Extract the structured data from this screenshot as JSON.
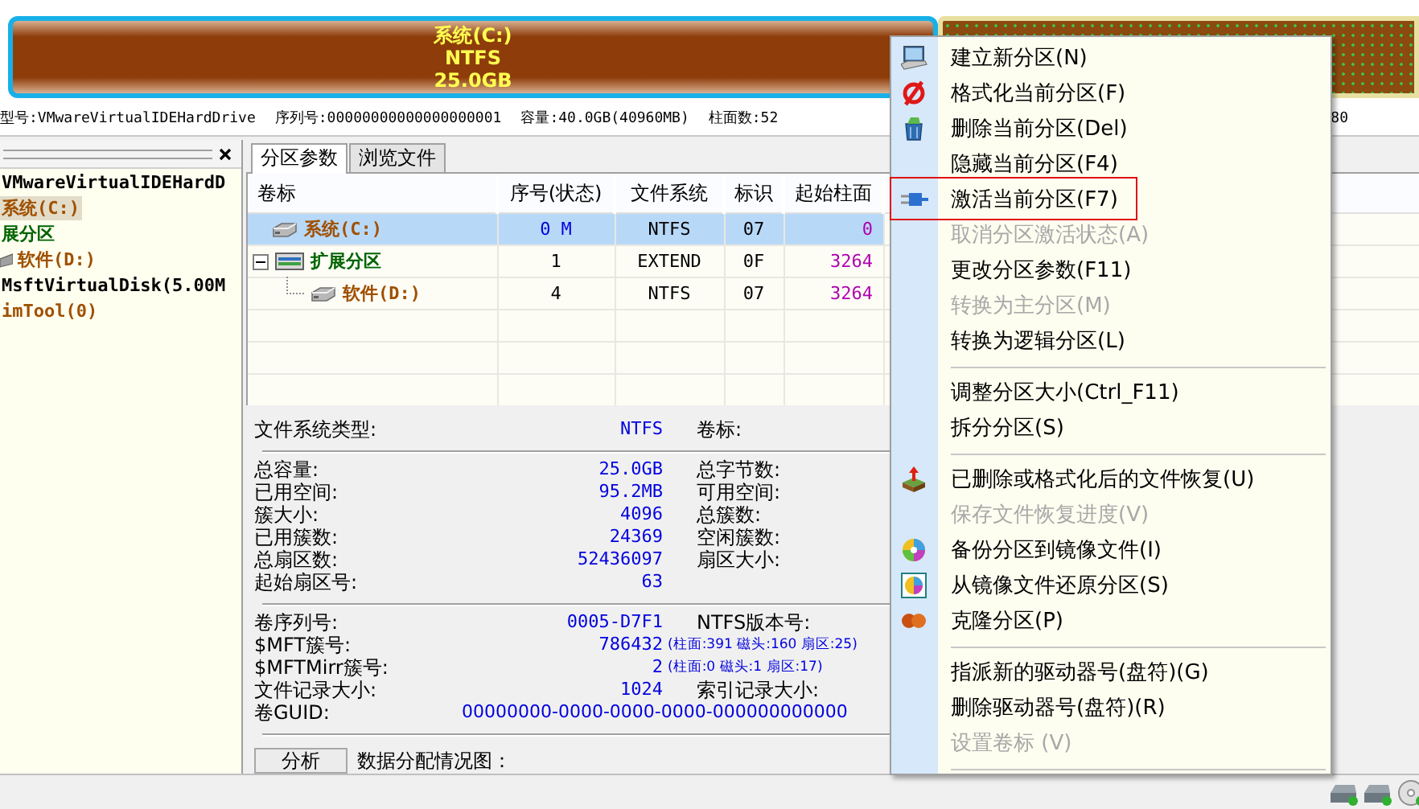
{
  "disk_map": {
    "partitions": [
      {
        "label": "系统(C:)",
        "file_system": "NTFS",
        "size": "25.0GB",
        "selected": true
      },
      {
        "selected": false
      }
    ]
  },
  "disk_info": [
    "型号:VMwareVirtualIDEHardDrive",
    "序列号:00000000000000000001",
    "容量:40.0GB(40960MB)",
    "柱面数:52",
    "80"
  ],
  "tree": [
    {
      "label": "VMwareVirtualIDEHardD",
      "kind": "disk",
      "children": [
        {
          "label": "系统(C:)",
          "kind": "primary",
          "selected": true
        },
        {
          "label": "展分区",
          "kind": "extended",
          "selected": false,
          "children": [
            {
              "label": "软件(D:)",
              "kind": "logical",
              "selected": false
            }
          ]
        }
      ]
    },
    {
      "label": "MsftVirtualDisk(5.00M",
      "kind": "disk",
      "children": [
        {
          "label": "imTool(0)",
          "kind": "primary",
          "selected": false
        }
      ]
    }
  ],
  "tabs": [
    {
      "label": "分区参数",
      "selected": true
    },
    {
      "label": "浏览文件",
      "selected": false
    }
  ],
  "table": {
    "columns": [
      "卷标",
      "序号(状态)",
      "文件系统",
      "标识",
      "起始柱面"
    ],
    "rows": [
      {
        "name": "系统(C:)",
        "kind": "primary",
        "index": "0 M",
        "file_system": "NTFS",
        "id": "07",
        "start_cylinder": "0",
        "selected": true
      },
      {
        "name": "扩展分区",
        "kind": "extended",
        "index": "1",
        "file_system": "EXTEND",
        "id": "0F",
        "start_cylinder": "3264",
        "selected": false,
        "expanded": true,
        "children": [
          {
            "name": "软件(D:)",
            "kind": "logical",
            "index": "4",
            "file_system": "NTFS",
            "id": "07",
            "start_cylinder": "3264",
            "selected": false
          }
        ]
      }
    ]
  },
  "details": [
    [
      {
        "label": "文件系统类型:",
        "value": "NTFS",
        "label_2": "卷标:"
      }
    ],
    [
      {
        "label": "总容量:",
        "value": "25.0GB",
        "label_2": "总字节数:"
      },
      {
        "label": "已用空间:",
        "value": "95.2MB",
        "label_2": "可用空间:"
      },
      {
        "label": "簇大小:",
        "value": "4096",
        "label_2": "总簇数:"
      },
      {
        "label": "已用簇数:",
        "value": "24369",
        "label_2": "空闲簇数:"
      },
      {
        "label": "总扇区数:",
        "value": "52436097",
        "label_2": "扇区大小:"
      },
      {
        "label": "起始扇区号:",
        "value": "63"
      }
    ],
    [
      {
        "label": "卷序列号:",
        "value": "0005-D7F1",
        "label_2": "NTFS版本号:"
      },
      {
        "label": "$MFT簇号:",
        "value": "786432",
        "detail": "(柱面:391 磁头:160 扇区:25)"
      },
      {
        "label": "$MFTMirr簇号:",
        "value": "2",
        "detail": "(柱面:0 磁头:1 扇区:17)"
      },
      {
        "label": "文件记录大小:",
        "value": "1024",
        "label_2": "索引记录大小:"
      },
      {
        "label": "卷GUID:",
        "value": "00000000-0000-0000-0000-000000000000",
        "kind": "wide"
      }
    ]
  ],
  "analyze_button": "分析",
  "allocation_label": "数据分配情况图：",
  "menu": {
    "items": [
      {
        "kind": "item",
        "label": "建立新分区(N)",
        "disabled": false
      },
      {
        "kind": "item",
        "label": "格式化当前分区(F)",
        "disabled": false
      },
      {
        "kind": "item",
        "label": "删除当前分区(Del)",
        "disabled": false
      },
      {
        "kind": "item",
        "label": "隐藏当前分区(F4)",
        "disabled": false
      },
      {
        "kind": "item",
        "label": "激活当前分区(F7)",
        "disabled": false,
        "highlighted": true
      },
      {
        "kind": "item",
        "label": "取消分区激活状态(A)",
        "disabled": true
      },
      {
        "kind": "item",
        "label": "更改分区参数(F11)",
        "disabled": false
      },
      {
        "kind": "item",
        "label": "转换为主分区(M)",
        "disabled": true
      },
      {
        "kind": "item",
        "label": "转换为逻辑分区(L)",
        "disabled": false
      },
      {
        "kind": "separator"
      },
      {
        "kind": "item",
        "label": "调整分区大小(Ctrl_F11)",
        "disabled": false
      },
      {
        "kind": "item",
        "label": "拆分分区(S)",
        "disabled": false
      },
      {
        "kind": "separator"
      },
      {
        "kind": "item",
        "label": "已删除或格式化后的文件恢复(U)",
        "disabled": false
      },
      {
        "kind": "item",
        "label": "保存文件恢复进度(V)",
        "disabled": true
      },
      {
        "kind": "item",
        "label": "备份分区到镜像文件(I)",
        "disabled": false
      },
      {
        "kind": "item",
        "label": "从镜像文件还原分区(S)",
        "disabled": false
      },
      {
        "kind": "item",
        "label": "克隆分区(P)",
        "disabled": false
      },
      {
        "kind": "separator"
      },
      {
        "kind": "item",
        "label": "指派新的驱动器号(盘符)(G)",
        "disabled": false
      },
      {
        "kind": "item",
        "label": "删除驱动器号(盘符)(R)",
        "disabled": false
      },
      {
        "kind": "item",
        "label": "设置卷标 (V)",
        "disabled": true
      },
      {
        "kind": "separator"
      }
    ]
  }
}
